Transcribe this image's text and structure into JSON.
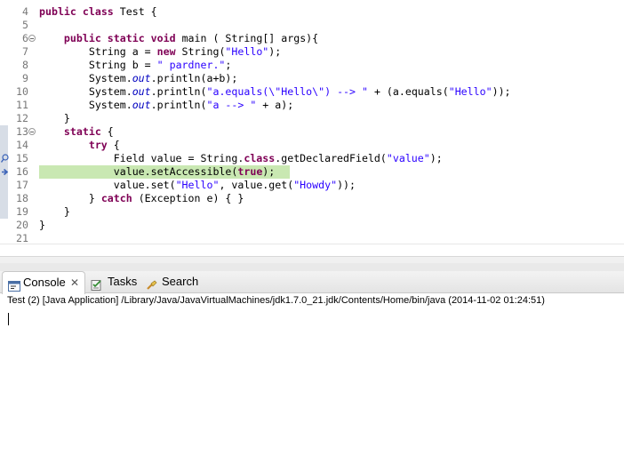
{
  "editor": {
    "lines": [
      {
        "num": "4",
        "tokens": [
          {
            "t": "public",
            "c": "kw"
          },
          {
            "t": " "
          },
          {
            "t": "class",
            "c": "kw"
          },
          {
            "t": " Test {"
          }
        ]
      },
      {
        "num": "5",
        "tokens": []
      },
      {
        "num": "6",
        "fold": true,
        "tokens": [
          {
            "t": "    "
          },
          {
            "t": "public",
            "c": "kw"
          },
          {
            "t": " "
          },
          {
            "t": "static",
            "c": "kw"
          },
          {
            "t": " "
          },
          {
            "t": "void",
            "c": "kw"
          },
          {
            "t": " main ( String[] args){"
          }
        ]
      },
      {
        "num": "7",
        "tokens": [
          {
            "t": "        String a = "
          },
          {
            "t": "new",
            "c": "kw"
          },
          {
            "t": " String("
          },
          {
            "t": "\"Hello\"",
            "c": "str"
          },
          {
            "t": ");"
          }
        ]
      },
      {
        "num": "8",
        "tokens": [
          {
            "t": "        String b = "
          },
          {
            "t": "\" pardner.\"",
            "c": "str"
          },
          {
            "t": ";"
          }
        ]
      },
      {
        "num": "9",
        "tokens": [
          {
            "t": "        System."
          },
          {
            "t": "out",
            "c": "fld"
          },
          {
            "t": ".println(a+b);"
          }
        ]
      },
      {
        "num": "10",
        "tokens": [
          {
            "t": "        System."
          },
          {
            "t": "out",
            "c": "fld"
          },
          {
            "t": ".println("
          },
          {
            "t": "\"a.equals(\\\"Hello\\\") --> \"",
            "c": "str"
          },
          {
            "t": " + (a.equals("
          },
          {
            "t": "\"Hello\"",
            "c": "str"
          },
          {
            "t": "));"
          }
        ]
      },
      {
        "num": "11",
        "tokens": [
          {
            "t": "        System."
          },
          {
            "t": "out",
            "c": "fld"
          },
          {
            "t": ".println("
          },
          {
            "t": "\"a --> \"",
            "c": "str"
          },
          {
            "t": " + a);"
          }
        ]
      },
      {
        "num": "12",
        "tokens": [
          {
            "t": "    }"
          }
        ]
      },
      {
        "num": "13",
        "fold": true,
        "tokens": [
          {
            "t": "    "
          },
          {
            "t": "static",
            "c": "kw"
          },
          {
            "t": " {"
          }
        ]
      },
      {
        "num": "14",
        "tokens": [
          {
            "t": "        "
          },
          {
            "t": "try",
            "c": "kw"
          },
          {
            "t": " {"
          }
        ]
      },
      {
        "num": "15",
        "marker": "search",
        "tokens": [
          {
            "t": "            Field value = String."
          },
          {
            "t": "class",
            "c": "kw"
          },
          {
            "t": ".getDeclaredField("
          },
          {
            "t": "\"value\"",
            "c": "str"
          },
          {
            "t": ");"
          }
        ]
      },
      {
        "num": "16",
        "marker": "debug",
        "current": true,
        "tokens": [
          {
            "t": "            value.setAccessible("
          },
          {
            "t": "true",
            "c": "kw"
          },
          {
            "t": ");"
          }
        ]
      },
      {
        "num": "17",
        "tokens": [
          {
            "t": "            value.set("
          },
          {
            "t": "\"Hello\"",
            "c": "str"
          },
          {
            "t": ", value.get("
          },
          {
            "t": "\"Howdy\"",
            "c": "str"
          },
          {
            "t": "));"
          }
        ]
      },
      {
        "num": "18",
        "tokens": [
          {
            "t": "        } "
          },
          {
            "t": "catch",
            "c": "kw"
          },
          {
            "t": " (Exception e) { }"
          }
        ]
      },
      {
        "num": "19",
        "tokens": [
          {
            "t": "    }"
          }
        ]
      },
      {
        "num": "20",
        "tokens": [
          {
            "t": "}"
          }
        ]
      },
      {
        "num": "21",
        "tokens": []
      }
    ]
  },
  "console_view": {
    "tabs": [
      {
        "label": "Console",
        "icon": "console-icon",
        "active": true,
        "closable": true
      },
      {
        "label": "Tasks",
        "icon": "tasks-icon",
        "active": false
      },
      {
        "label": "Search",
        "icon": "search-icon",
        "active": false
      }
    ],
    "title": "Test (2) [Java Application] /Library/Java/JavaVirtualMachines/jdk1.7.0_21.jdk/Contents/Home/bin/java (2014-11-02 01:24:51)",
    "output": ""
  },
  "colors": {
    "keyword": "#7f0055",
    "string": "#2a00ff",
    "field": "#0000c0",
    "current_line": "#c9e8b2"
  }
}
